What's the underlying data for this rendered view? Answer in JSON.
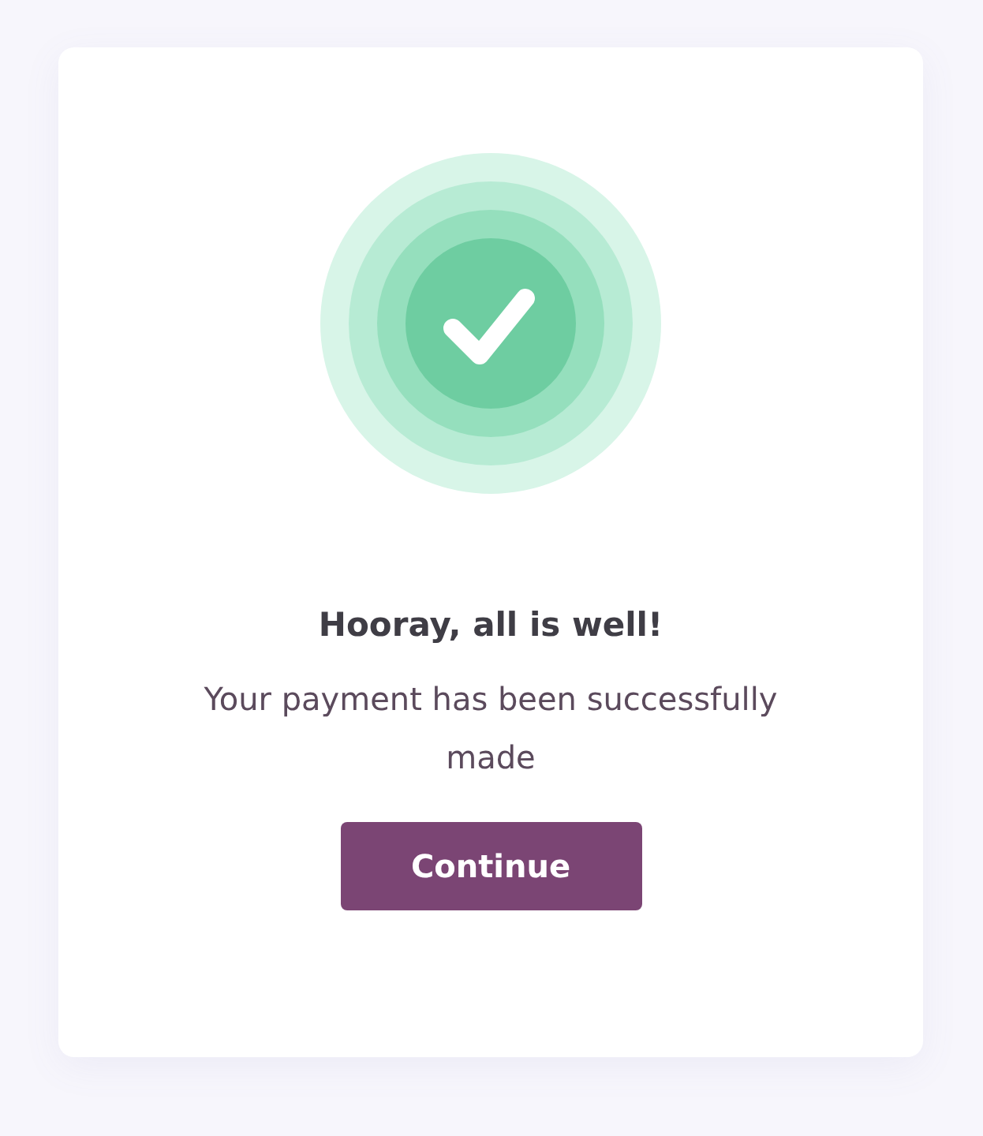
{
  "card": {
    "title": "Hooray, all is well!",
    "message": "Your payment has been successfully made",
    "button": {
      "label": "Continue"
    }
  }
}
